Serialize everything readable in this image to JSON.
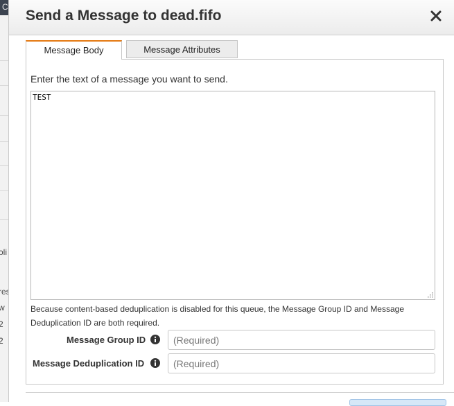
{
  "dialog": {
    "title": "Send a Message to dead.fifo"
  },
  "tabs": [
    {
      "label": "Message Body",
      "active": true
    },
    {
      "label": "Message Attributes",
      "active": false
    }
  ],
  "body_tab": {
    "instruction": "Enter the text of a message you want to send.",
    "message_value": "TEST",
    "dedup_note": "Because content-based deduplication is disabled for this queue, the Message Group ID and Message Deduplication ID are both required."
  },
  "fields": {
    "group_id": {
      "label": "Message Group ID",
      "placeholder": "(Required)",
      "value": ""
    },
    "dedup_id": {
      "label": "Message Deduplication ID",
      "placeholder": "(Required)",
      "value": ""
    }
  },
  "background_page": {
    "header_fragment": "C",
    "text_fragments": [
      "oli",
      "res",
      "w",
      "2",
      "2"
    ]
  },
  "colors": {
    "active_tab_accent": "#e47911",
    "header_bar": "#3c4450",
    "info_icon": "#333333"
  },
  "icons": {
    "close": "close-icon",
    "info": "info-icon",
    "resize": "resize-grip-icon"
  }
}
